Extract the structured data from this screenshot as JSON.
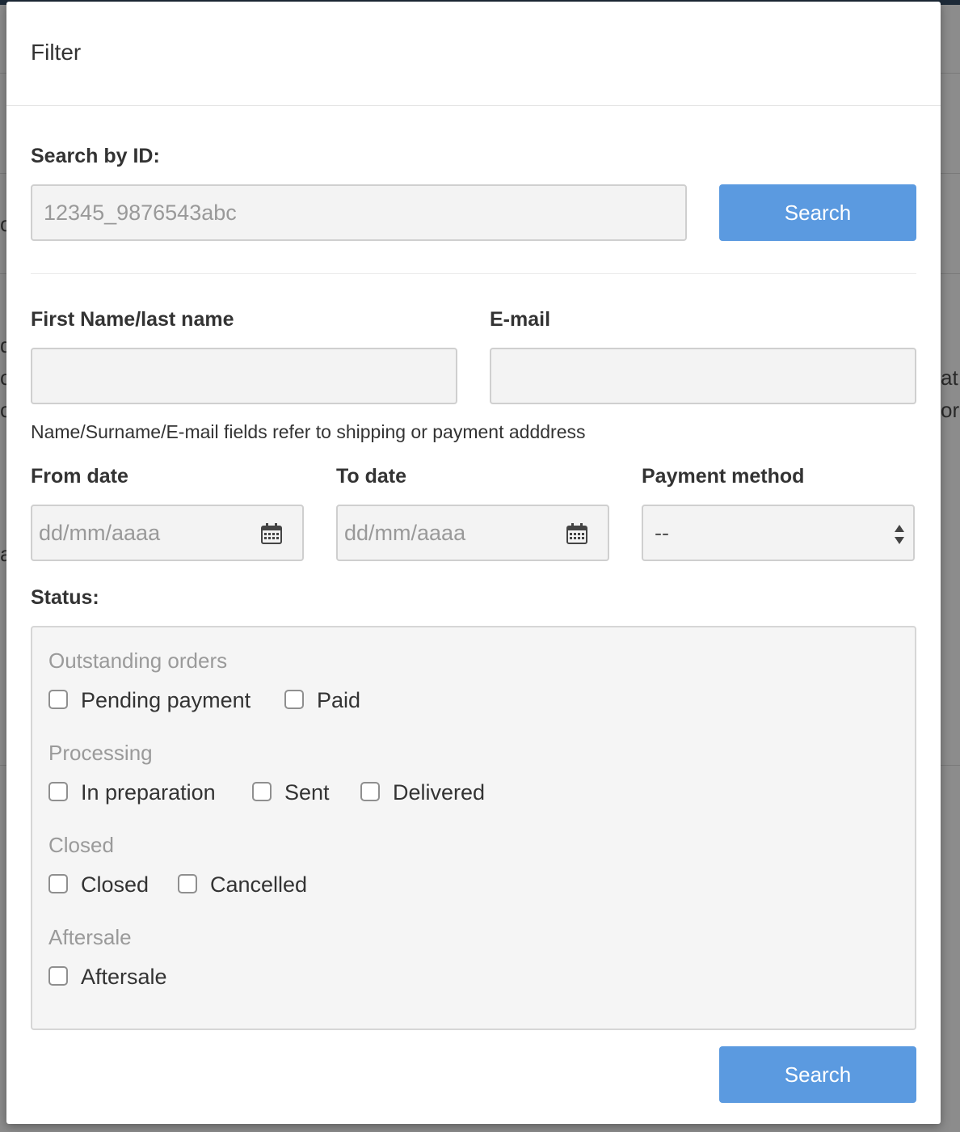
{
  "modal": {
    "title": "Filter"
  },
  "search_by_id": {
    "label": "Search by ID:",
    "placeholder": "12345_9876543abc",
    "button_label": "Search"
  },
  "name_field": {
    "label": "First Name/last name",
    "value": ""
  },
  "email_field": {
    "label": "E-mail",
    "value": ""
  },
  "help_text": "Name/Surname/E-mail fields refer to shipping or payment adddress",
  "from_date": {
    "label": "From date",
    "placeholder": "dd/mm/aaaa"
  },
  "to_date": {
    "label": "To date",
    "placeholder": "dd/mm/aaaa"
  },
  "payment_method": {
    "label": "Payment method",
    "selected": "--"
  },
  "status": {
    "label": "Status:",
    "groups": [
      {
        "title": "Outstanding orders",
        "options": [
          "Pending payment",
          "Paid"
        ]
      },
      {
        "title": "Processing",
        "options": [
          "In preparation",
          "Sent",
          "Delivered"
        ]
      },
      {
        "title": "Closed",
        "options": [
          "Closed",
          "Cancelled"
        ]
      },
      {
        "title": "Aftersale",
        "options": [
          "Aftersale"
        ]
      }
    ]
  },
  "footer": {
    "search_label": "Search"
  },
  "colors": {
    "primary_button": "#5b9ae0",
    "field_bg": "#f3f3f3",
    "status_box_bg": "#f5f5f5"
  },
  "background_fragments": [
    "d",
    "c",
    "c",
    "a",
    "o",
    "at",
    "or"
  ]
}
